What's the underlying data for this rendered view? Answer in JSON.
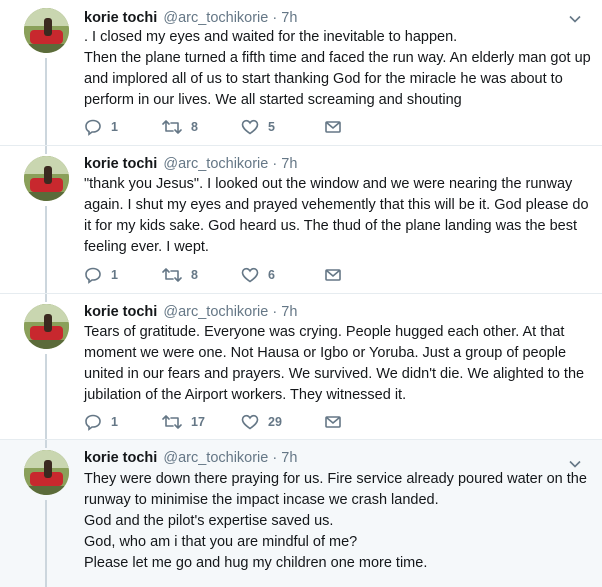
{
  "tweets": [
    {
      "name": "korie tochi",
      "handle": "@arc_tochikorie",
      "separator": "·",
      "time": "7h",
      "lines": [
        ". I closed my eyes and waited for the inevitable to happen.",
        "Then the plane turned a fifth time and faced the run way. An elderly man got up",
        "and implored all of us to start thanking God for the miracle he was about to",
        "perform in our lives. We all started screaming and shouting"
      ],
      "replies": "1",
      "retweets": "8",
      "likes": "5"
    },
    {
      "name": "korie tochi",
      "handle": "@arc_tochikorie",
      "separator": "·",
      "time": "7h",
      "lines": [
        "\"thank you Jesus\". I looked out the window and we were nearing the runway",
        "again. I shut my eyes and prayed vehemently that this will be it. God please do",
        "it for my kids sake. God heard us. The thud of the plane landing was the best",
        "feeling ever. I wept."
      ],
      "replies": "1",
      "retweets": "8",
      "likes": "6"
    },
    {
      "name": "korie tochi",
      "handle": "@arc_tochikorie",
      "separator": "·",
      "time": "7h",
      "lines": [
        "Tears of gratitude. Everyone was crying. People hugged each other. At that",
        "moment we were one. Not Hausa or Igbo or Yoruba. Just a group of people",
        "united in our fears and prayers. We survived. We didn't die. We alighted to the",
        "jubilation of the Airport workers. They witnessed it."
      ],
      "replies": "1",
      "retweets": "17",
      "likes": "29"
    },
    {
      "name": "korie tochi",
      "handle": "@arc_tochikorie",
      "separator": "·",
      "time": "7h",
      "lines": [
        "They were down there praying for us. Fire service already poured water on the",
        "runway to minimise the impact incase we crash landed.",
        "God and the pilot's expertise saved us.",
        "God, who am i that you are mindful of me?",
        "Please let me go and hug my children one more time."
      ],
      "replies": "",
      "retweets": "",
      "likes": ""
    }
  ],
  "colors": {
    "name": "#14171a",
    "meta": "#657786",
    "icon": "#657786",
    "divider": "#e6ecf0",
    "highlight_bg": "#f5f8fa",
    "thread_line": "#ccd6dd"
  },
  "icons": {
    "reply": "reply-icon",
    "retweet": "retweet-icon",
    "like": "heart-icon",
    "dm": "envelope-icon",
    "menu": "chevron-down-icon"
  }
}
